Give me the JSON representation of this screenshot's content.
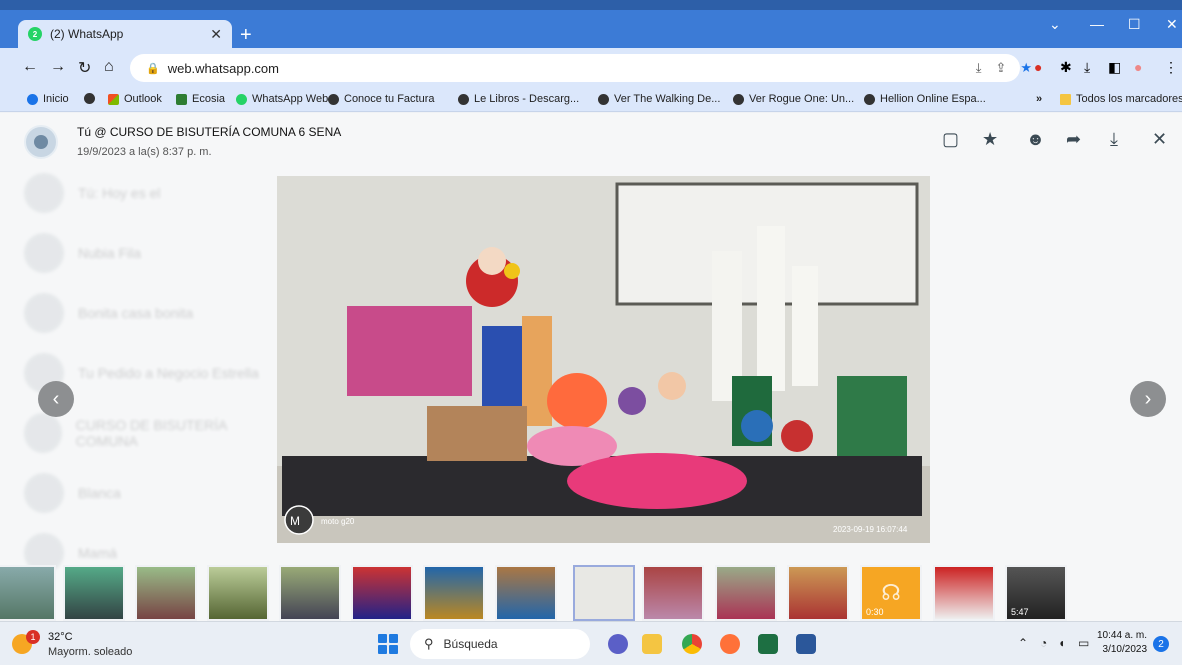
{
  "browser": {
    "tab_title": "(2) WhatsApp",
    "tab_badge": "2",
    "url": "web.whatsapp.com",
    "bookmarks": [
      "Inicio",
      "Outlook",
      "Ecosia",
      "WhatsApp Web",
      "Conoce tu Factura",
      "Le Libros - Descarg...",
      "Ver The Walking De...",
      "Ver Rogue One: Un...",
      "Hellion Online Espa..."
    ],
    "bookmarks_overflow": "»",
    "all_bookmarks": "Todos los marcadores"
  },
  "viewer": {
    "sender": "Tú @ CURSO DE BISUTERÍA COMUNA 6 SENA",
    "timestamp": "19/9/2023 a la(s) 8:37 p. m.",
    "photo_caption": "moto g20",
    "photo_datestamp": "2023-09-19 16:07:44",
    "prev_label": "‹",
    "next_label": "›",
    "ghost_chats": [
      "Tú: Hoy es el",
      "Nubia Fila",
      "Bonita casa bonita",
      "Tu Pedido a Negocio Estrella",
      "CURSO DE BISUTERÍA COMUNA",
      "Blanca",
      "Mamá"
    ]
  },
  "thumbnails": {
    "audio_duration": "0:30",
    "video_duration": "5:47"
  },
  "taskbar": {
    "badge": "1",
    "temperature": "32°C",
    "condition": "Mayorm. soleado",
    "search_placeholder": "Búsqueda",
    "time": "10:44 a. m.",
    "date": "3/10/2023",
    "notifications": "2"
  },
  "colors": {
    "chrome_blue": "#3c7bd6",
    "toolbar": "#dbe7fb",
    "whatsapp_green": "#25d366"
  }
}
